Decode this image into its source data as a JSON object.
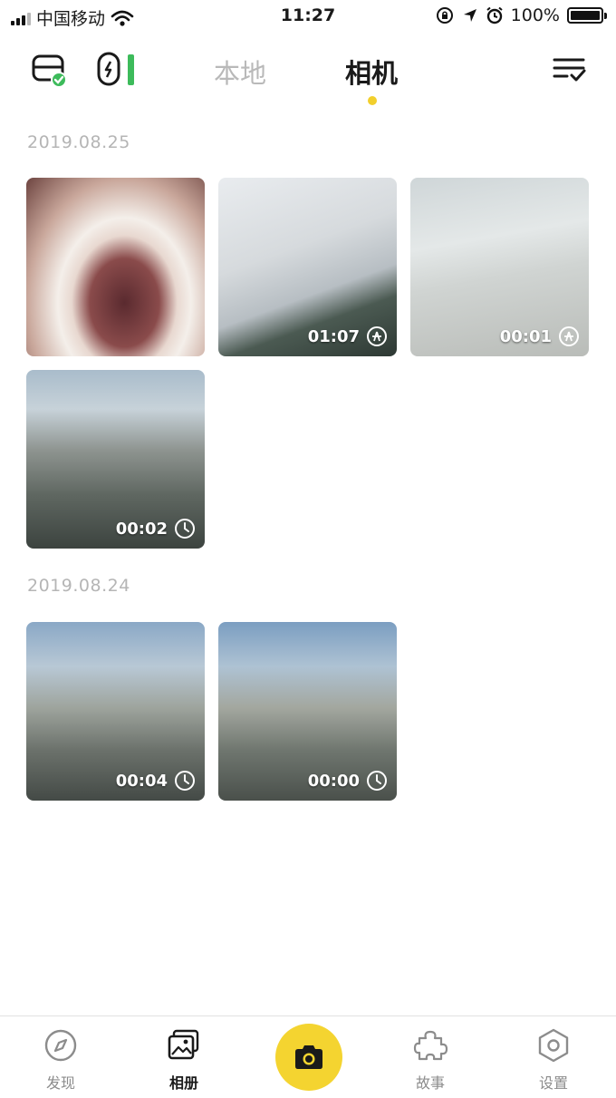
{
  "status_bar": {
    "carrier": "中国移动",
    "time": "11:27",
    "battery": "100%"
  },
  "top_nav": {
    "tabs": [
      {
        "label": "本地",
        "active": false
      },
      {
        "label": "相机",
        "active": true
      }
    ]
  },
  "groups": [
    {
      "date": "2019.08.25",
      "items": [
        {
          "duration": "",
          "badge": ""
        },
        {
          "duration": "01:07",
          "badge": "timelapse-icon"
        },
        {
          "duration": "00:01",
          "badge": "timelapse-icon"
        },
        {
          "duration": "00:02",
          "badge": "clock-icon"
        }
      ]
    },
    {
      "date": "2019.08.24",
      "items": [
        {
          "duration": "00:04",
          "badge": "clock-icon"
        },
        {
          "duration": "00:00",
          "badge": "clock-icon"
        }
      ]
    }
  ],
  "tab_bar": {
    "items": [
      {
        "label": "发现",
        "icon": "compass-icon",
        "active": false
      },
      {
        "label": "相册",
        "icon": "album-icon",
        "active": true
      },
      {
        "label": "",
        "icon": "camera-icon",
        "active": false
      },
      {
        "label": "故事",
        "icon": "puzzle-icon",
        "active": false
      },
      {
        "label": "设置",
        "icon": "hexagon-settings-icon",
        "active": false
      }
    ]
  },
  "colors": {
    "accent": "#f4d430",
    "inactive_tab": "#b9b9b9",
    "date_text": "#b5b5b5",
    "connected_green": "#3dbb5b"
  }
}
